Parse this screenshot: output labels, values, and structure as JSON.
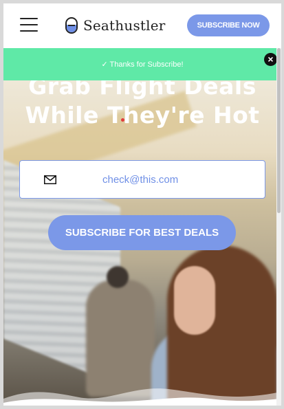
{
  "header": {
    "brand_name": "Seathustler",
    "subscribe_button": "SUBSCRIBE NOW"
  },
  "toast": {
    "message": "✓ Thanks for Subscribe!",
    "close_icon": "close-icon"
  },
  "hero": {
    "headline_line1": "Grab Flight Deals",
    "headline_line2": "While They're Hot",
    "email_value": "check@this.com",
    "mail_icon": "mail-icon",
    "cta_label": "SUBSCRIBE FOR BEST DEALS"
  },
  "colors": {
    "accent": "#7b98e8",
    "toast": "#5fe9a7",
    "text_dark": "#222222"
  }
}
